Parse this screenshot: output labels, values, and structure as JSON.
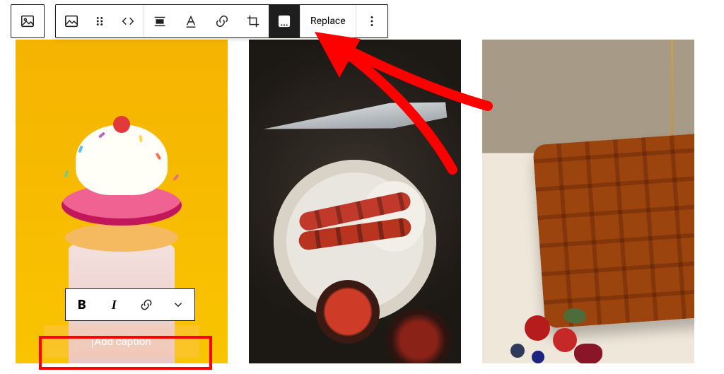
{
  "block_type_icon": "image-block-icon",
  "toolbar": {
    "replace_label": "Replace"
  },
  "caption_toolbar": {
    "bold_glyph": "B",
    "italic_glyph": "I"
  },
  "caption": {
    "placeholder": "Add caption"
  },
  "annotation": {
    "arrow_color": "#ff0000",
    "highlight_color": "#ff0000",
    "target": "duotone-filter-button"
  }
}
